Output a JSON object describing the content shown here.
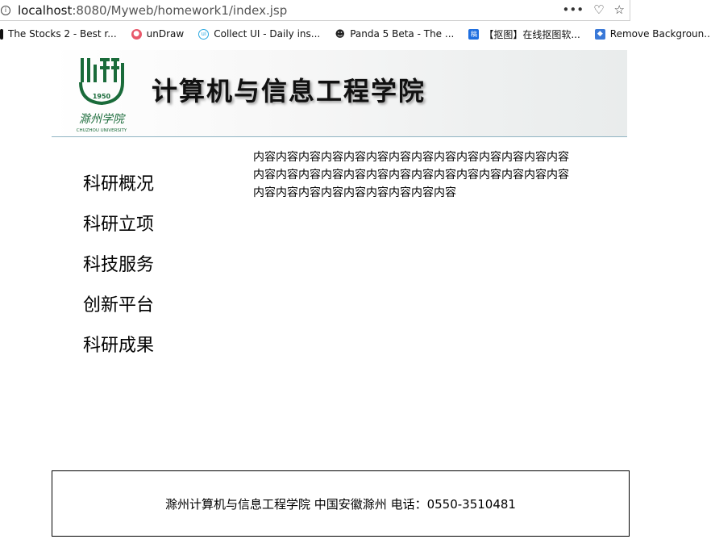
{
  "browser": {
    "url_host": "localhost",
    "url_rest": ":8080/Myweb/homework1/index.jsp",
    "actions": [
      "•••",
      "♡",
      "☆"
    ],
    "bookmarks": [
      {
        "label": "The Stocks 2 - Best r...",
        "icon": "stocks-icon",
        "color": "#111111"
      },
      {
        "label": "unDraw",
        "icon": "undraw-icon",
        "color": "#e8586a"
      },
      {
        "label": "Collect UI - Daily ins...",
        "icon": "collectui-icon",
        "color": "#2aa8e0"
      },
      {
        "label": "Panda 5 Beta - The ...",
        "icon": "panda-icon",
        "color": "#333333"
      },
      {
        "label": "【抠图】在线抠图软...",
        "icon": "koutu-icon",
        "color": "#1f6fe0"
      },
      {
        "label": "Remove Backgroun...",
        "icon": "removebg-icon",
        "color": "#3a79d8"
      },
      {
        "label": "",
        "icon": "tb-icon",
        "color": "#3cc8d8"
      }
    ]
  },
  "header": {
    "title": "计算机与信息工程学院",
    "logo": {
      "year": "1950",
      "name_cn": "滁州学院",
      "name_en": "CHUZHOU UNIVERSITY",
      "color": "#1a6b3a"
    }
  },
  "sidebar": {
    "items": [
      {
        "label": "科研概况"
      },
      {
        "label": "科研立项"
      },
      {
        "label": "科技服务"
      },
      {
        "label": "创新平台"
      },
      {
        "label": "科研成果"
      }
    ]
  },
  "main": {
    "content": "内容内容内容内容内容内容内容内容内容内容内容内容内容内容内容内容内容内容内容内容内容内容内容内容内容内容内容内容内容内容内容内容内容内容内容内容内容"
  },
  "footer": {
    "text": "滁州计算机与信息工程学院 中国安徽滁州 电话：0550-3510481"
  }
}
